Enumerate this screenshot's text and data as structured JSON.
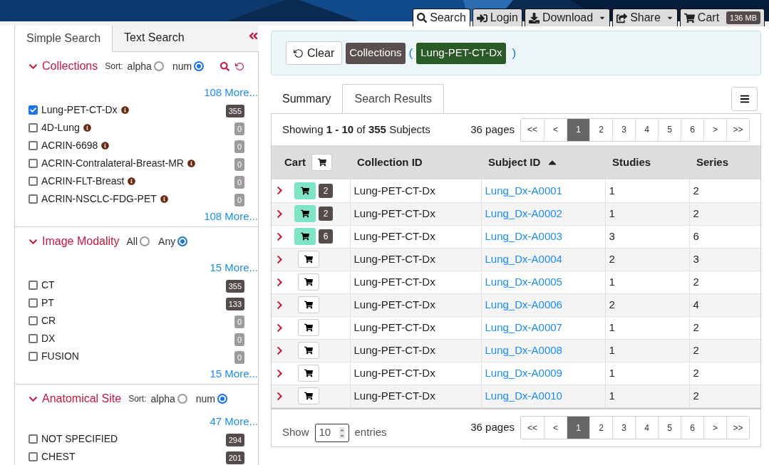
{
  "nav": [
    {
      "kind": "search",
      "label": "Search",
      "selected": true
    },
    {
      "kind": "login",
      "label": "Login",
      "selected": false
    },
    {
      "kind": "download",
      "label": "Download",
      "selected": false,
      "dropdown": true
    },
    {
      "kind": "share",
      "label": "Share",
      "selected": false,
      "dropdown": true
    },
    {
      "kind": "cart",
      "label": "Cart",
      "selected": false,
      "badge": "136 MB"
    }
  ],
  "search_tabs": [
    {
      "label": "Simple Search",
      "selected": true
    },
    {
      "label": "Text Search",
      "selected": false
    }
  ],
  "facets": [
    {
      "title": "Collections",
      "expanded": true,
      "mode_label": "Sort:",
      "options": [
        {
          "label": "alpha",
          "selected": false
        },
        {
          "label": "num",
          "selected": true
        }
      ],
      "tools": true,
      "more_top": "108 More...",
      "more_bottom": "108 More...",
      "items": [
        {
          "label": "Lung-PET-CT-Dx",
          "checked": true,
          "info": true,
          "count": "355"
        },
        {
          "label": "4D-Lung",
          "checked": false,
          "info": true,
          "count": "0"
        },
        {
          "label": "ACRIN-6698",
          "checked": false,
          "info": true,
          "count": "0"
        },
        {
          "label": "ACRIN-Contralateral-Breast-MR",
          "checked": false,
          "info": true,
          "count": "0"
        },
        {
          "label": "ACRIN-FLT-Breast",
          "checked": false,
          "info": true,
          "count": "0"
        },
        {
          "label": "ACRIN-NSCLC-FDG-PET",
          "checked": false,
          "info": true,
          "count": "0"
        }
      ]
    },
    {
      "title": "Image Modality",
      "expanded": true,
      "options": [
        {
          "label": "All",
          "selected": false
        },
        {
          "label": "Any",
          "selected": true
        }
      ],
      "more_top": "15 More...",
      "more_bottom": "15 More...",
      "items": [
        {
          "label": "CT",
          "checked": false,
          "count": "355"
        },
        {
          "label": "PT",
          "checked": false,
          "count": "133"
        },
        {
          "label": "CR",
          "checked": false,
          "count": "0"
        },
        {
          "label": "DX",
          "checked": false,
          "count": "0"
        },
        {
          "label": "FUSION",
          "checked": false,
          "count": "0"
        }
      ]
    },
    {
      "title": "Anatomical Site",
      "expanded": true,
      "mode_label": "Sort:",
      "options": [
        {
          "label": "alpha",
          "selected": false
        },
        {
          "label": "num",
          "selected": true
        }
      ],
      "more_top": "47 More...",
      "items": [
        {
          "label": "NOT SPECIFIED",
          "checked": false,
          "count": "294"
        },
        {
          "label": "CHEST",
          "checked": false,
          "count": "201"
        }
      ]
    }
  ],
  "criteria": {
    "clear": "Clear",
    "field": "Collections",
    "open": "(",
    "values": [
      "Lung-PET-CT-Dx"
    ],
    "close": ")"
  },
  "result_tabs": [
    {
      "label": "Summary",
      "selected": false
    },
    {
      "label": "Search Results",
      "selected": true
    }
  ],
  "summary": "Showing **1 - 10** of **355** Subjects",
  "pages_label": "36 pages",
  "pager": [
    {
      "label": "<<",
      "selected": false
    },
    {
      "label": "<",
      "selected": false
    },
    {
      "label": "1",
      "selected": true
    },
    {
      "label": "2",
      "selected": false
    },
    {
      "label": "3",
      "selected": false
    },
    {
      "label": "4",
      "selected": false
    },
    {
      "label": "5",
      "selected": false
    },
    {
      "label": "6",
      "selected": false
    },
    {
      "label": ">",
      "selected": false
    },
    {
      "label": ">>",
      "selected": false
    }
  ],
  "pager_bottom": [
    {
      "label": "<<",
      "selected": false
    },
    {
      "label": "<",
      "selected": false
    },
    {
      "label": "1",
      "selected": true
    },
    {
      "label": "2",
      "selected": false
    },
    {
      "label": "3",
      "selected": false
    },
    {
      "label": "4",
      "selected": false
    },
    {
      "label": "5",
      "selected": false
    },
    {
      "label": "6",
      "selected": false
    },
    {
      "label": ">",
      "selected": false
    },
    {
      "label": ">>",
      "selected": false
    }
  ],
  "table": {
    "columns": [
      {
        "label": "Cart",
        "sorted": false
      },
      {
        "label": "Collection ID",
        "sorted": false
      },
      {
        "label": "Subject ID",
        "sorted": true
      },
      {
        "label": "Studies",
        "sorted": false
      },
      {
        "label": "Series",
        "sorted": false
      }
    ],
    "rows": [
      {
        "in_cart": true,
        "cart_count": "2",
        "collection": "Lung-PET-CT-Dx",
        "subject": "Lung_Dx-A0001",
        "studies": "1",
        "series": "2"
      },
      {
        "in_cart": true,
        "cart_count": "2",
        "collection": "Lung-PET-CT-Dx",
        "subject": "Lung_Dx-A0002",
        "studies": "1",
        "series": "2"
      },
      {
        "in_cart": true,
        "cart_count": "6",
        "collection": "Lung-PET-CT-Dx",
        "subject": "Lung_Dx-A0003",
        "studies": "3",
        "series": "6"
      },
      {
        "in_cart": false,
        "collection": "Lung-PET-CT-Dx",
        "subject": "Lung_Dx-A0004",
        "studies": "2",
        "series": "3"
      },
      {
        "in_cart": false,
        "collection": "Lung-PET-CT-Dx",
        "subject": "Lung_Dx-A0005",
        "studies": "1",
        "series": "2"
      },
      {
        "in_cart": false,
        "collection": "Lung-PET-CT-Dx",
        "subject": "Lung_Dx-A0006",
        "studies": "2",
        "series": "4"
      },
      {
        "in_cart": false,
        "collection": "Lung-PET-CT-Dx",
        "subject": "Lung_Dx-A0007",
        "studies": "1",
        "series": "2"
      },
      {
        "in_cart": false,
        "collection": "Lung-PET-CT-Dx",
        "subject": "Lung_Dx-A0008",
        "studies": "1",
        "series": "2"
      },
      {
        "in_cart": false,
        "collection": "Lung-PET-CT-Dx",
        "subject": "Lung_Dx-A0009",
        "studies": "1",
        "series": "2"
      },
      {
        "in_cart": false,
        "collection": "Lung-PET-CT-Dx",
        "subject": "Lung_Dx-A0010",
        "studies": "1",
        "series": "2"
      }
    ]
  },
  "footer": {
    "show": "Show",
    "page_size": "10",
    "entries": "entries",
    "pages_label": "36 pages"
  }
}
